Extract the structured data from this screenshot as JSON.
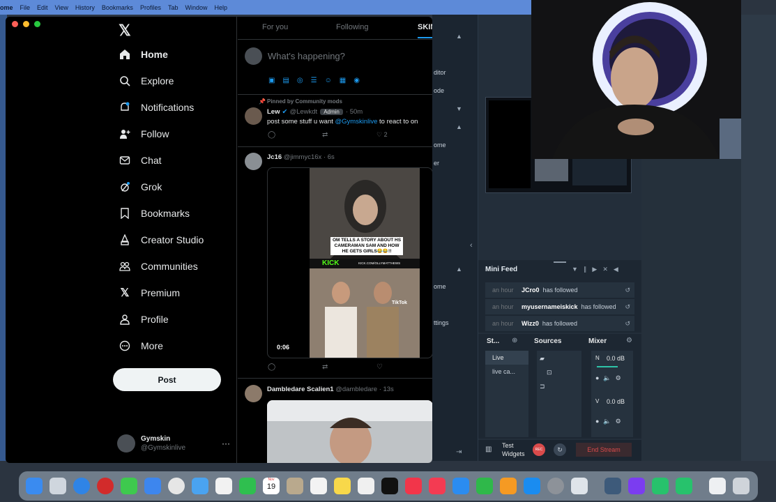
{
  "menubar": {
    "app": "ome",
    "items": [
      "File",
      "Edit",
      "View",
      "History",
      "Bookmarks",
      "Profiles",
      "Tab",
      "Window",
      "Help"
    ]
  },
  "nav": {
    "items": [
      {
        "label": "Home",
        "icon": "home-icon"
      },
      {
        "label": "Explore",
        "icon": "search-icon"
      },
      {
        "label": "Notifications",
        "icon": "bell-icon"
      },
      {
        "label": "Follow",
        "icon": "add-user-icon"
      },
      {
        "label": "Chat",
        "icon": "mail-icon"
      },
      {
        "label": "Grok",
        "icon": "grok-icon"
      },
      {
        "label": "Bookmarks",
        "icon": "bookmark-icon"
      },
      {
        "label": "Creator Studio",
        "icon": "creator-icon"
      },
      {
        "label": "Communities",
        "icon": "communities-icon"
      },
      {
        "label": "Premium",
        "icon": "x-logo-icon"
      },
      {
        "label": "Profile",
        "icon": "person-icon"
      },
      {
        "label": "More",
        "icon": "more-circle-icon"
      }
    ],
    "post_label": "Post"
  },
  "account": {
    "name": "Gymskin",
    "handle": "@Gymskinlive"
  },
  "tabs": {
    "for_you": "For you",
    "following": "Following",
    "skin": "SKIN"
  },
  "compose": {
    "placeholder": "What's happening?"
  },
  "pinned": {
    "label": "Pinned by Community mods",
    "name": "Lew",
    "handle": "@Lewkdt",
    "badge": "Admin",
    "time": "· 50m",
    "text_pre": "post some stuff u want ",
    "mention": "@Gymskinlive",
    "text_post": " to react to on",
    "likes": "2"
  },
  "tweet2": {
    "name": "Jc16",
    "handle": "@jimmyc16x",
    "time": "· 6s",
    "duration": "0:06",
    "caption": "OM TELLS A STORY ABOUT HS CAMERAMAN SAM AND HOW HE GETS GIRLS😂😂!!",
    "kick": "KICK",
    "url": "KICK.COM/OLLYMATTHEWS",
    "tiktok": "TikTok"
  },
  "tweet3": {
    "name": "Dambledare Scalien1",
    "handle": "@dambledare",
    "time": "· 13s"
  },
  "obs": {
    "side_labels": [
      "ditor",
      "ode",
      "ome",
      "er",
      "ome",
      "ttings"
    ],
    "minifeed_title": "Mini Feed",
    "feed": [
      {
        "time": "an hour",
        "user": "JCro0",
        "action": "has followed"
      },
      {
        "time": "an hour",
        "user": "myusernameiskick",
        "action": "has followed"
      },
      {
        "time": "an hour",
        "user": "Wizz0",
        "action": "has followed"
      }
    ],
    "scenes_title": "St...",
    "sources_title": "Sources",
    "mixer_title": "Mixer",
    "scenes": [
      "Live",
      "live ca..."
    ],
    "mixer": [
      {
        "label": "N",
        "db": "0.0 dB"
      },
      {
        "label": "V",
        "db": "0.0 dB"
      }
    ],
    "test_widgets": "Test Widgets",
    "rec": "REC",
    "end_stream": "End Stream"
  },
  "dock": {
    "calendar_month": "Nov",
    "calendar_day": "19"
  },
  "colors": {
    "accent": "#1d9bf0",
    "end_stream": "#d94b4b",
    "obs_bg": "#1f2a36"
  }
}
